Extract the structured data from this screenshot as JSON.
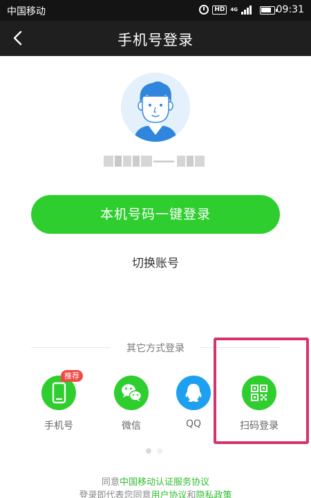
{
  "status_bar": {
    "carrier": "中国移动",
    "hd": "HD",
    "network": "4G",
    "time": "09:31"
  },
  "header": {
    "title": "手机号登录"
  },
  "account": {
    "masked_number_visible": false
  },
  "primary_button": {
    "label": "本机号码一键登录",
    "color": "#2dce2d"
  },
  "switch_account": {
    "label": "切换账号"
  },
  "other_methods": {
    "title": "其它方式登录",
    "items": [
      {
        "label": "手机号",
        "icon": "phone-icon",
        "color": "#2dce2d",
        "badge": "推荐"
      },
      {
        "label": "微信",
        "icon": "wechat-icon",
        "color": "#2dce2d"
      },
      {
        "label": "QQ",
        "icon": "qq-icon",
        "color": "#1ea0f0"
      },
      {
        "label": "扫码登录",
        "icon": "qr-code-icon",
        "color": "#2dce2d"
      }
    ]
  },
  "annotation": {
    "highlight_color": "#d6336c"
  },
  "pager": {
    "pages": 2,
    "current": 1
  },
  "agreement": {
    "line1_prefix": "同意",
    "line1_link": "中国移动认证服务协议",
    "line2_prefix": "登录即代表您同意",
    "line2_link1": "用户协议",
    "line2_and": "和",
    "line2_link2": "隐私政策"
  }
}
